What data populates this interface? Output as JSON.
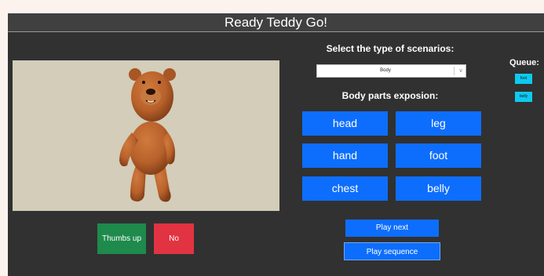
{
  "app": {
    "title": "Ready Teddy Go!"
  },
  "feedback": {
    "thumbs_up_label": "Thumbs up",
    "no_label": "No"
  },
  "scenarios": {
    "heading": "Select the type of scenarios:",
    "selected": "Body",
    "chevron": "∨"
  },
  "body_parts": {
    "heading": "Body parts exposion:",
    "items": [
      "head",
      "leg",
      "hand",
      "foot",
      "chest",
      "belly"
    ]
  },
  "controls": {
    "play_next_label": "Play next",
    "play_sequence_label": "Play sequence"
  },
  "queue": {
    "heading": "Queue:",
    "items": [
      "foot",
      "belly"
    ]
  },
  "colors": {
    "primary": "#0d6efd",
    "success": "#1e8a4c",
    "danger": "#e23342",
    "info": "#0dcaf0",
    "panel": "#313131",
    "viewport_bg": "#d3cdb9",
    "teddy": "#b8612b"
  }
}
